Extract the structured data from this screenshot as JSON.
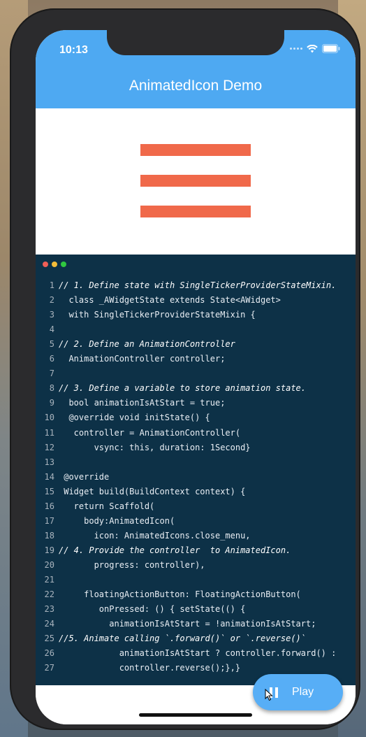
{
  "status_bar": {
    "time": "10:13"
  },
  "app_bar": {
    "title": "AnimatedIcon Demo"
  },
  "animated_icon": {
    "name": "menu-icon",
    "color": "#f0694a"
  },
  "code": {
    "lines": [
      {
        "n": "1",
        "text": "// 1. Define state with SingleTickerProviderStateMixin.",
        "indent": 0,
        "style": "comment"
      },
      {
        "n": "2",
        "text": "  class _AWidgetState extends State<AWidget>",
        "indent": 0,
        "style": "code"
      },
      {
        "n": "3",
        "text": "  with SingleTickerProviderStateMixin {",
        "indent": 0,
        "style": "code"
      },
      {
        "n": "4",
        "text": "",
        "indent": 0,
        "style": "code"
      },
      {
        "n": "5",
        "text": "// 2. Define an AnimationController",
        "indent": 0,
        "style": "comment"
      },
      {
        "n": "6",
        "text": "  AnimationController controller;",
        "indent": 0,
        "style": "code"
      },
      {
        "n": "7",
        "text": "",
        "indent": 0,
        "style": "code"
      },
      {
        "n": "8",
        "text": "// 3. Define a variable to store animation state.",
        "indent": 0,
        "style": "comment"
      },
      {
        "n": "9",
        "text": "  bool animationIsAtStart = true;",
        "indent": 0,
        "style": "code"
      },
      {
        "n": "10",
        "text": "  @override void initState() {",
        "indent": 0,
        "style": "code"
      },
      {
        "n": "11",
        "text": "   controller = AnimationController(",
        "indent": 0,
        "style": "code"
      },
      {
        "n": "12",
        "text": "       vsync: this, duration: 1Second}",
        "indent": 0,
        "style": "code"
      },
      {
        "n": "13",
        "text": "",
        "indent": 0,
        "style": "code"
      },
      {
        "n": "14",
        "text": " @override",
        "indent": 0,
        "style": "code"
      },
      {
        "n": "15",
        "text": " Widget build(BuildContext context) {",
        "indent": 0,
        "style": "code"
      },
      {
        "n": "16",
        "text": "   return Scaffold(",
        "indent": 0,
        "style": "code"
      },
      {
        "n": "17",
        "text": "     body:AnimatedIcon(",
        "indent": 0,
        "style": "code"
      },
      {
        "n": "18",
        "text": "       icon: AnimatedIcons.close_menu,",
        "indent": 0,
        "style": "code"
      },
      {
        "n": "19",
        "text": "// 4. Provide the controller  to AnimatedIcon.",
        "indent": -1,
        "style": "comment"
      },
      {
        "n": "20",
        "text": "       progress: controller),",
        "indent": 0,
        "style": "code"
      },
      {
        "n": "21",
        "text": "",
        "indent": 0,
        "style": "code"
      },
      {
        "n": "22",
        "text": "     floatingActionButton: FloatingActionButton(",
        "indent": 0,
        "style": "code"
      },
      {
        "n": "23",
        "text": "        onPressed: () { setState(() {",
        "indent": 0,
        "style": "code"
      },
      {
        "n": "24",
        "text": "          animationIsAtStart = !animationIsAtStart;",
        "indent": 0,
        "style": "code"
      },
      {
        "n": "25",
        "text": "//5. Animate calling `.forward()` or `.reverse()`",
        "indent": -1,
        "style": "comment"
      },
      {
        "n": "26",
        "text": "            animationIsAtStart ? controller.forward() :",
        "indent": 0,
        "style": "code"
      },
      {
        "n": "27",
        "text": "            controller.reverse();},}",
        "indent": 0,
        "style": "code"
      }
    ]
  },
  "fab": {
    "label": "Play",
    "icon": "pause-icon"
  },
  "colors": {
    "app_bar": "#4ea9f2",
    "code_background": "#0d3147",
    "fab": "#57aef6",
    "traffic_red": "#ef5f57",
    "traffic_yellow": "#f4bd39",
    "traffic_green": "#2fc840"
  }
}
